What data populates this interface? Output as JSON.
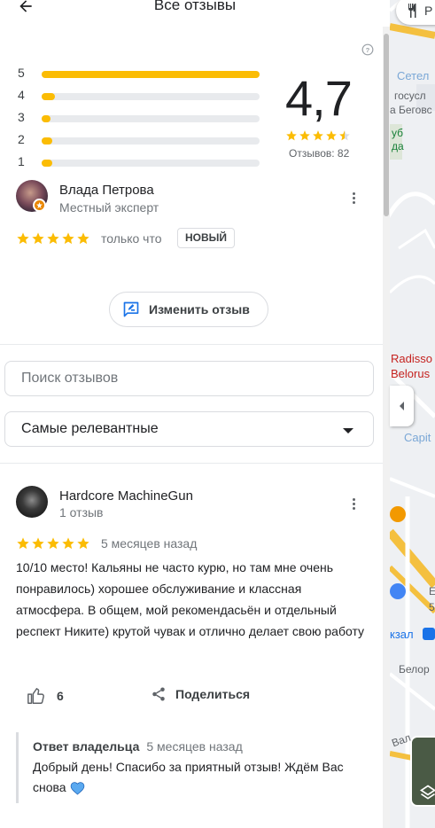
{
  "header": {
    "title": "Все отзывы"
  },
  "summary": {
    "rating": "4,7",
    "review_count_text": "Отзывов: 82",
    "stars_filled": 4.5,
    "distribution": [
      {
        "label": "5",
        "fraction": 1.0
      },
      {
        "label": "4",
        "fraction": 0.06
      },
      {
        "label": "3",
        "fraction": 0.02
      },
      {
        "label": "2",
        "fraction": 0.05
      },
      {
        "label": "1",
        "fraction": 0.05
      }
    ]
  },
  "own_review": {
    "name": "Влада Петрова",
    "subtitle": "Местный эксперт",
    "stars": 5,
    "time": "только что",
    "badge": "НОВЫЙ",
    "edit_label": "Изменить отзыв"
  },
  "search": {
    "placeholder": "Поиск отзывов"
  },
  "sort": {
    "selected": "Самые релевантные"
  },
  "reviews": [
    {
      "name": "Hardcore MachineGun",
      "subtitle": "1 отзыв",
      "stars": 5,
      "time": "5 месяцев назад",
      "text": "10/10 место! Кальяны не часто курю, но там мне очень понравилось) хорошее обслуживание и классная атмосфера. В общем, мой рекомендасьён и отдельный респект Никите) крутой чувак и отлично делает свою работу",
      "likes": "6",
      "share_label": "Поделиться",
      "owner_reply": {
        "title": "Ответ владельца",
        "time": "5 месяцев назад",
        "text": "Добрый день! Спасибо за приятный отзыв! Ждём Вас снова"
      }
    }
  ],
  "map": {
    "chip_label": "Р",
    "labels": [
      {
        "text": "Сетел",
        "color": "#7aa7d6"
      },
      {
        "text": "госусл",
        "color": "#5f6368"
      },
      {
        "text": "а Беговс",
        "color": "#5f6368"
      },
      {
        "text": "уб",
        "color": "#188038"
      },
      {
        "text": "да",
        "color": "#188038"
      },
      {
        "text": "Radisso",
        "color": "#c5221f"
      },
      {
        "text": "Belorus",
        "color": "#c5221f"
      },
      {
        "text": "Capit",
        "color": "#7aa7d6"
      },
      {
        "text": "Е",
        "color": "#5f6368"
      },
      {
        "text": "5",
        "color": "#5f6368"
      },
      {
        "text": "кзал",
        "color": "#1a73e8"
      },
      {
        "text": "Белор",
        "color": "#5f6368"
      },
      {
        "text": "Вал",
        "color": "#5f6368"
      }
    ]
  },
  "colors": {
    "star": "#fbbc04",
    "accent": "#1a73e8",
    "new_badge_border": "#dadce0"
  },
  "icons": [
    "back-arrow-icon",
    "help-icon",
    "star-icon",
    "more-vert-icon",
    "edit-review-icon",
    "dropdown-arrow-icon",
    "thumb-up-icon",
    "share-icon",
    "heart-icon",
    "fork-knife-icon",
    "layers-icon",
    "collapse-arrow-icon"
  ]
}
